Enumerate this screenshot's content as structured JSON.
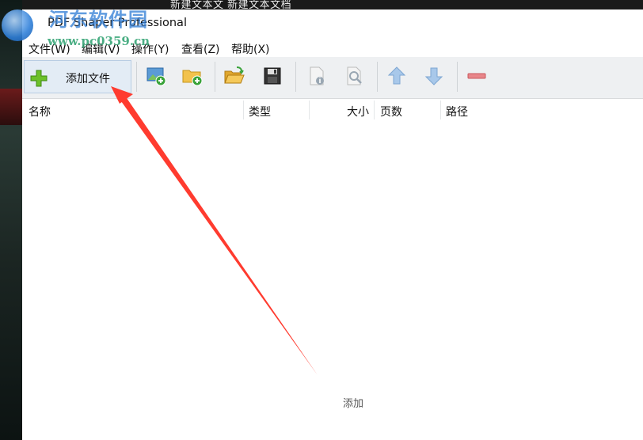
{
  "desktop": {
    "top_text": "新建文本文    新建文本文档"
  },
  "window": {
    "title": "PDF Shaper Professional"
  },
  "watermark": {
    "name": "河东软件园",
    "url": "www.pc0359.cn"
  },
  "menu": {
    "items": [
      "文件(W)",
      "编辑(V)",
      "操作(Y)",
      "查看(Z)",
      "帮助(X)"
    ]
  },
  "toolbar": {
    "add_file_label": "添加文件",
    "icons": [
      "add-image-icon",
      "add-folder-icon",
      "open-folder-icon",
      "save-icon",
      "document-info-icon",
      "document-search-icon",
      "move-up-icon",
      "move-down-icon",
      "remove-icon"
    ]
  },
  "columns": {
    "name": "名称",
    "type": "类型",
    "size": "大小",
    "pages": "页数",
    "path": "路径"
  },
  "annotation": {
    "text": "添加"
  },
  "colors": {
    "arrow": "#ff3b2f",
    "plus_green": "#6cc02a",
    "toolbar_bg": "#eef0f2",
    "button_hover": "#e3ecf5"
  }
}
